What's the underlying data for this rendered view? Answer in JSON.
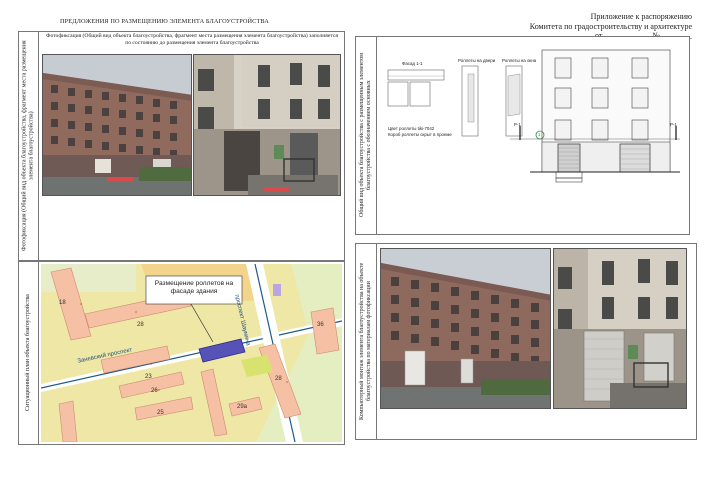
{
  "header": {
    "left_title": "ПРЕДЛОЖЕНИЯ ПО РАЗМЕЩЕНИЮ ЭЛЕМЕНТА БЛАГОУСТРОЙСТВА",
    "right_line1": "Приложение к распоряжению",
    "right_line2": "Комитета по градостроительству и архитектуре",
    "right_line3": "от____________ №________"
  },
  "photo_panel": {
    "side_label": "Фотофиксация (Общий вид объекта благоустройства, фрагмент места размещения элемента благоустройства)",
    "caption": "Фотофиксация (Общий вид объекта благоустройства, фрагмент места размещения элемента благоустройства) заполняется по состоянию до размещения элемента благоустройства"
  },
  "situation_panel": {
    "side_label": "Ситуационный план объекта благоустройства",
    "callout": "Размещение роллетов на фасаде здания",
    "street1": "Заневский проспект",
    "street2": "проспект Шаумяна",
    "labels": [
      "18",
      "28",
      "23",
      "26",
      "25",
      "28",
      "29а",
      "36"
    ]
  },
  "drawing_panel": {
    "side_label": "Общий вид объекта благоустройства с размещенным элементом благоустройства с обозначением основных",
    "facade_title": "Фасад 1-1",
    "roller_door_title": "Роллеты на двери",
    "roller_window_title": "Роллеты на окна",
    "note_line1": "Цвет роллеты tiki-7042",
    "note_line2": "Короб роллеты скрыт в проеме",
    "axis_left": "P-1",
    "axis_right": "P-1",
    "axis_marker": "1"
  },
  "montage_panel": {
    "side_label": "Компьютерный монтаж элемента благоустройства на объекте благоустройства по материалам фотофиксации"
  }
}
